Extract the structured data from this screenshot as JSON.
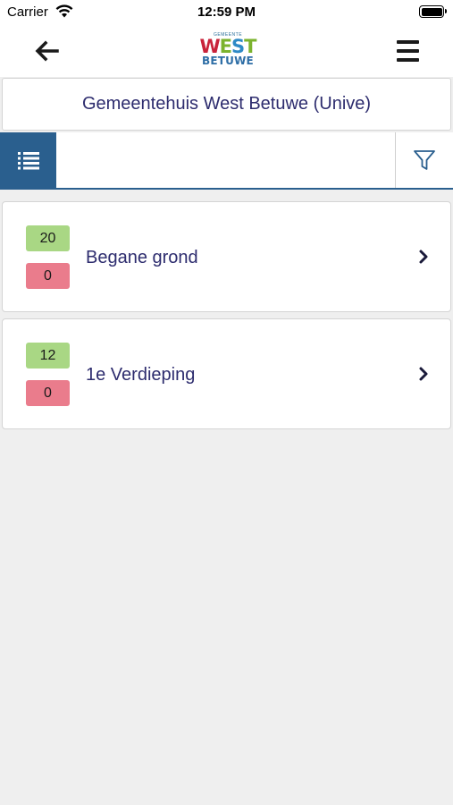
{
  "status_bar": {
    "carrier": "Carrier",
    "time": "12:59 PM"
  },
  "header": {
    "logo": {
      "top": "GEMEENTE",
      "word1_letters": [
        "W",
        "E",
        "S",
        "T"
      ],
      "word2": "BETUWE"
    },
    "back_icon": "arrow-left-icon",
    "menu_icon": "hamburger-menu-icon"
  },
  "location": {
    "title": "Gemeentehuis West Betuwe (Unive)"
  },
  "toolbar": {
    "list_icon": "list-icon",
    "filter_icon": "filter-icon",
    "search_value": ""
  },
  "floors": [
    {
      "name": "Begane grond",
      "green_count": "20",
      "red_count": "0"
    },
    {
      "name": "1e Verdieping",
      "green_count": "12",
      "red_count": "0"
    }
  ],
  "colors": {
    "primary": "#2a5f8e",
    "text": "#2d2c6e",
    "badge_green": "#a9d784",
    "badge_red": "#ea7c8c",
    "background": "#efefef"
  }
}
